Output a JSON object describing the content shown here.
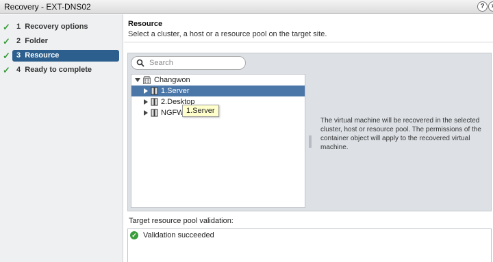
{
  "window": {
    "title": "Recovery - EXT-DNS02",
    "help_icon": "help-icon",
    "close_icon": "close-icon"
  },
  "steps": [
    {
      "number": "1",
      "label": "Recovery options",
      "done": true,
      "active": false
    },
    {
      "number": "2",
      "label": "Folder",
      "done": true,
      "active": false
    },
    {
      "number": "3",
      "label": "Resource",
      "done": true,
      "active": true
    },
    {
      "number": "4",
      "label": "Ready to complete",
      "done": true,
      "active": false
    }
  ],
  "resource": {
    "title": "Resource",
    "subtitle": "Select a cluster, a host or a resource pool on the target site.",
    "search_placeholder": "Search",
    "tree": {
      "root": "Changwon",
      "children": [
        "1.Server",
        "2.Desktop",
        "NGFW"
      ],
      "selected": "1.Server"
    },
    "tooltip": "1.Server",
    "description": "The virtual machine will be recovered in the selected cluster, host or resource pool. The permissions of the container object will apply to the recovered virtual machine."
  },
  "validation": {
    "label": "Target resource pool validation:",
    "message": "Validation succeeded",
    "status_color": "#3a9c3a"
  },
  "colors": {
    "accent": "#2c5f8e",
    "selection": "#4a76a8",
    "check": "#3a9c3a"
  }
}
